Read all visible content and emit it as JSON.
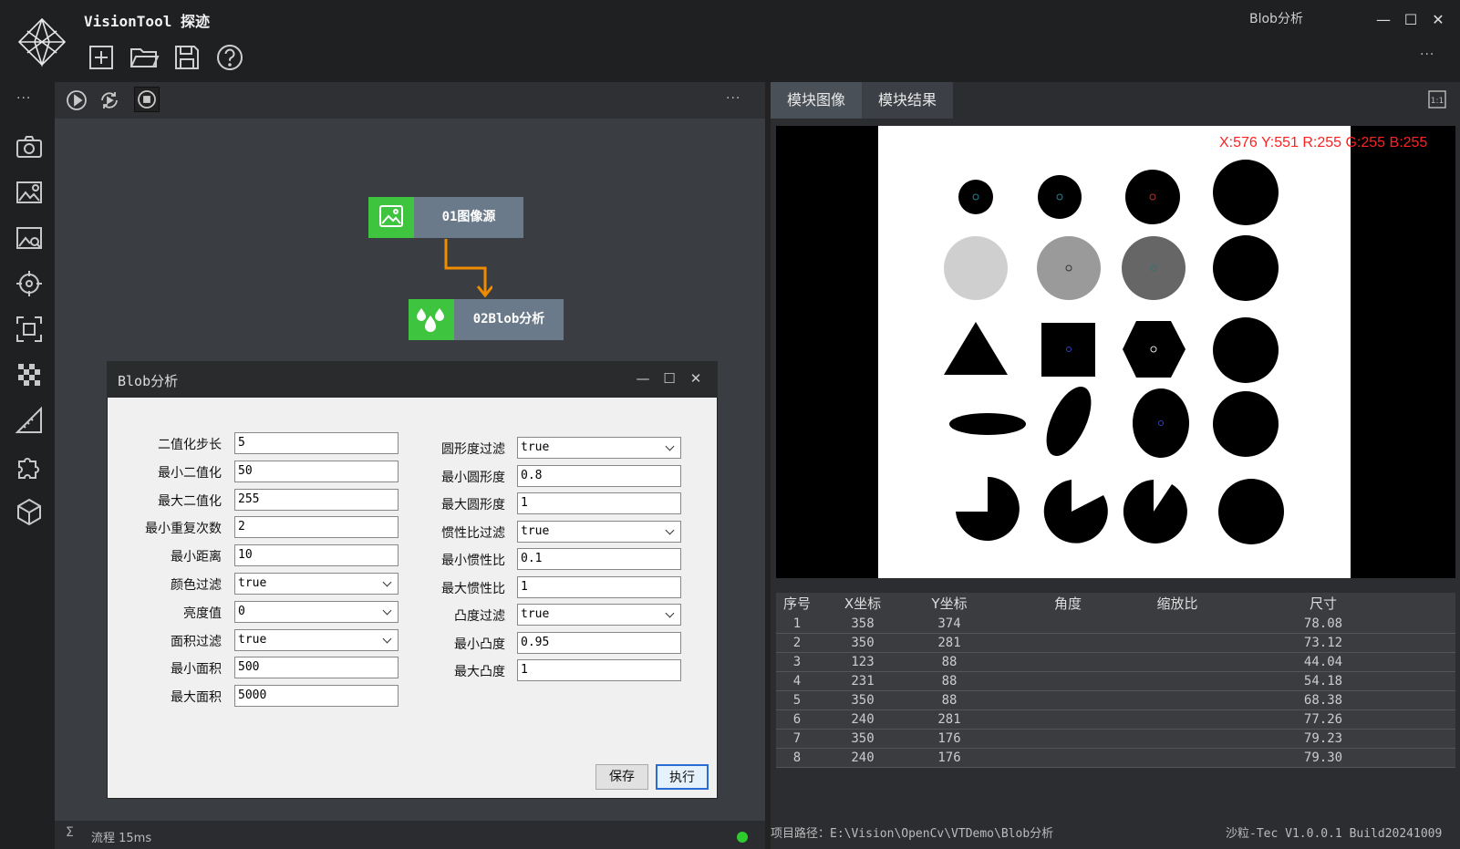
{
  "app": {
    "title": "VisionTool 探迹",
    "module_title": "Blob分析"
  },
  "flow": {
    "nodes": [
      {
        "label": "01图像源"
      },
      {
        "label": "02Blob分析"
      }
    ],
    "status": {
      "text": "流程 15ms"
    }
  },
  "dialog": {
    "title": "Blob分析",
    "left_fields": [
      {
        "label": "二值化步长",
        "value": "5",
        "type": "text"
      },
      {
        "label": "最小二值化",
        "value": "50",
        "type": "text"
      },
      {
        "label": "最大二值化",
        "value": "255",
        "type": "text"
      },
      {
        "label": "最小重复次数",
        "value": "2",
        "type": "text"
      },
      {
        "label": "最小距离",
        "value": "10",
        "type": "text"
      },
      {
        "label": "颜色过滤",
        "value": "true",
        "type": "select"
      },
      {
        "label": "亮度值",
        "value": "0",
        "type": "select"
      },
      {
        "label": "面积过滤",
        "value": "true",
        "type": "select"
      },
      {
        "label": "最小面积",
        "value": "500",
        "type": "text"
      },
      {
        "label": "最大面积",
        "value": "5000",
        "type": "text"
      }
    ],
    "right_fields": [
      {
        "label": "圆形度过滤",
        "value": "true",
        "type": "select"
      },
      {
        "label": "最小圆形度",
        "value": "0.8",
        "type": "text"
      },
      {
        "label": "最大圆形度",
        "value": "1",
        "type": "text"
      },
      {
        "label": "惯性比过滤",
        "value": "true",
        "type": "select"
      },
      {
        "label": "最小惯性比",
        "value": "0.1",
        "type": "text"
      },
      {
        "label": "最大惯性比",
        "value": "1",
        "type": "text"
      },
      {
        "label": "凸度过滤",
        "value": "true",
        "type": "select"
      },
      {
        "label": "最小凸度",
        "value": "0.95",
        "type": "text"
      },
      {
        "label": "最大凸度",
        "value": "1",
        "type": "text"
      }
    ],
    "save_label": "保存",
    "run_label": "执行"
  },
  "right_panel": {
    "tabs": [
      "模块图像",
      "模块结果"
    ],
    "pixel_readout": "X:576 Y:551  R:255 G:255 B:255",
    "table": {
      "headers": [
        "序号",
        "X坐标",
        "Y坐标",
        "角度",
        "缩放比",
        "尺寸"
      ],
      "rows": [
        [
          "1",
          "358",
          "374",
          "",
          "",
          "78.08"
        ],
        [
          "2",
          "350",
          "281",
          "",
          "",
          "73.12"
        ],
        [
          "3",
          "123",
          "88",
          "",
          "",
          "44.04"
        ],
        [
          "4",
          "231",
          "88",
          "",
          "",
          "54.18"
        ],
        [
          "5",
          "350",
          "88",
          "",
          "",
          "68.38"
        ],
        [
          "6",
          "240",
          "281",
          "",
          "",
          "77.26"
        ],
        [
          "7",
          "350",
          "176",
          "",
          "",
          "79.23"
        ],
        [
          "8",
          "240",
          "176",
          "",
          "",
          "79.30"
        ]
      ]
    },
    "project_path": "项目路径：E:\\Vision\\OpenCv\\VTDemo\\Blob分析",
    "version": "沙粒-Tec V1.0.0.1 Build20241009"
  },
  "colors": {
    "accent_green": "#3ec43e",
    "readout_red": "#ff2020",
    "connector_orange": "#f08c00"
  }
}
